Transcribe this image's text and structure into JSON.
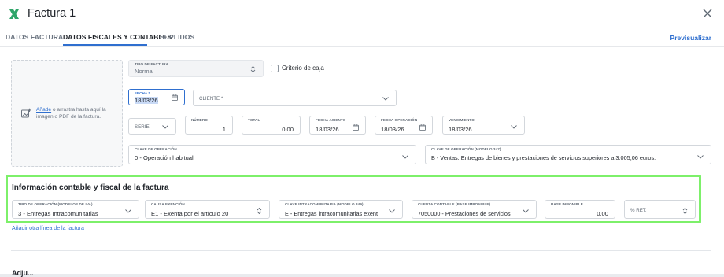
{
  "window": {
    "title": "Factura 1",
    "close_icon": "close-icon"
  },
  "tabs": [
    {
      "label": "DATOS FACTURA"
    },
    {
      "label": "DATOS FISCALES Y CONTABLES"
    },
    {
      "label": "SUPLIDOS"
    }
  ],
  "preview_label": "Previsualizar",
  "upload": {
    "link": "Añade",
    "text": " o arrastra hasta aquí la imagen o PDF de la factura.",
    "icon": "image-add-icon"
  },
  "fields": {
    "tipo_factura": {
      "label": "TIPO DE FACTURA",
      "value": "Normal"
    },
    "criterio_caja": {
      "label": "Criterio de caja",
      "checked": false
    },
    "fecha": {
      "label": "FECHA *",
      "value": "18/03/26"
    },
    "cliente": {
      "placeholder": "CLIENTE *"
    },
    "serie": {
      "placeholder": "SERIE"
    },
    "numero": {
      "label": "NÚMERO",
      "value": "1"
    },
    "total": {
      "label": "TOTAL",
      "value": "0,00"
    },
    "fecha_asiento": {
      "label": "FECHA ASIENTO",
      "value": "18/03/26"
    },
    "fecha_operacion": {
      "label": "FECHA OPERACIÓN",
      "value": "18/03/26"
    },
    "vencimiento": {
      "label": "VENCIMIENTO",
      "value": "18/03/26"
    },
    "clave_operacion": {
      "label": "CLAVE DE OPERACIÓN",
      "value": "0 - Operación habitual"
    },
    "clave_operacion_347": {
      "label": "CLAVE DE OPERACIÓN (MODELO 347)",
      "value": "B - Ventas: Entregas de bienes y prestaciones de servicios superiores a 3.005,06 euros."
    }
  },
  "section": {
    "title": "Información contable y fiscal de la factura",
    "tipo_operacion": {
      "label": "TIPO DE OPERACIÓN (MODELOS DE IVA)",
      "value": "3 - Entregas Intracomunitarias"
    },
    "causa_exencion": {
      "label": "CAUSA EXENCIÓN",
      "value": "E1 - Exenta por el artículo 20"
    },
    "clave_intracomunitaria": {
      "label": "CLAVE INTRACOMUNITARIA (MODELO 349)",
      "value": "E - Entregas intracomunitarias exent"
    },
    "cuenta_contable": {
      "label": "CUENTA CONTABLE (BASE IMPONIBLE)",
      "value": "7050000 - Prestaciones de servicios"
    },
    "base_imponible": {
      "label": "BASE IMPONIBLE",
      "value": "0,00"
    },
    "ret": {
      "placeholder": "% RET."
    }
  },
  "add_line": "Añadir otra línea de la factura",
  "next_section_heading": "Adju...",
  "colors": {
    "accent": "#2f6fcf",
    "highlight": "#7df06a",
    "logo": "#2fa66a"
  }
}
